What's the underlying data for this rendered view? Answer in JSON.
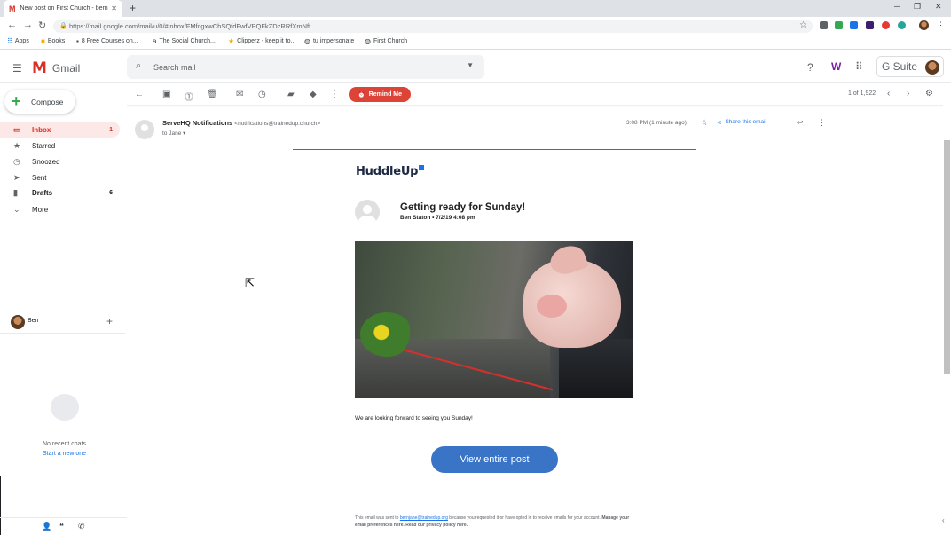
{
  "browser": {
    "tab_title": "New post on First Church - bern",
    "url": "https://mail.google.com/mail/u/0/#inbox/FMfcgxwChSQfdFwfVPQFkZDzRRfXmNft",
    "bookmarks": [
      "Apps",
      "Books",
      "8 Free Courses on...",
      "The Social Church...",
      "Clipperz - keep it to...",
      "tu impersonate",
      "First Church"
    ]
  },
  "header": {
    "app_name": "Gmail",
    "search_placeholder": "Search mail",
    "gsuite_label": "G Suite"
  },
  "sidebar": {
    "compose_label": "Compose",
    "items": [
      {
        "label": "Inbox",
        "count": "1"
      },
      {
        "label": "Starred",
        "count": ""
      },
      {
        "label": "Snoozed",
        "count": ""
      },
      {
        "label": "Sent",
        "count": ""
      },
      {
        "label": "Drafts",
        "count": "6"
      },
      {
        "label": "More",
        "count": ""
      }
    ],
    "hangouts_user": "Ben",
    "no_chats": "No recent chats",
    "start_new": "Start a new one"
  },
  "toolbar": {
    "remind_label": "Remind Me",
    "pager": "1 of 1,922"
  },
  "email": {
    "sender_name": "ServeHQ Notifications",
    "sender_email": "<notifications@trainedup.church>",
    "to_line": "to Jane",
    "time": "3:08 PM (1 minute ago)",
    "share_label": "Share this email",
    "brand": "HuddleUp",
    "post_title": "Getting ready for Sunday!",
    "post_meta": "Ben Staton • 7/2/19 4:08 pm",
    "message": "We are looking forward to seeing you Sunday!",
    "cta": "View entire post",
    "footer_prefix": "This email was sent to",
    "footer_email": "bernjane@trainedup.org",
    "footer_rest": "because you requested it or have opted in to receive emails for your account.",
    "footer_links": "Manage your email preferences here. Read our privacy policy here."
  },
  "colors": {
    "accent": "#d93025",
    "button": "#3a74c7",
    "remind": "#db4437",
    "link": "#1a73e8"
  }
}
